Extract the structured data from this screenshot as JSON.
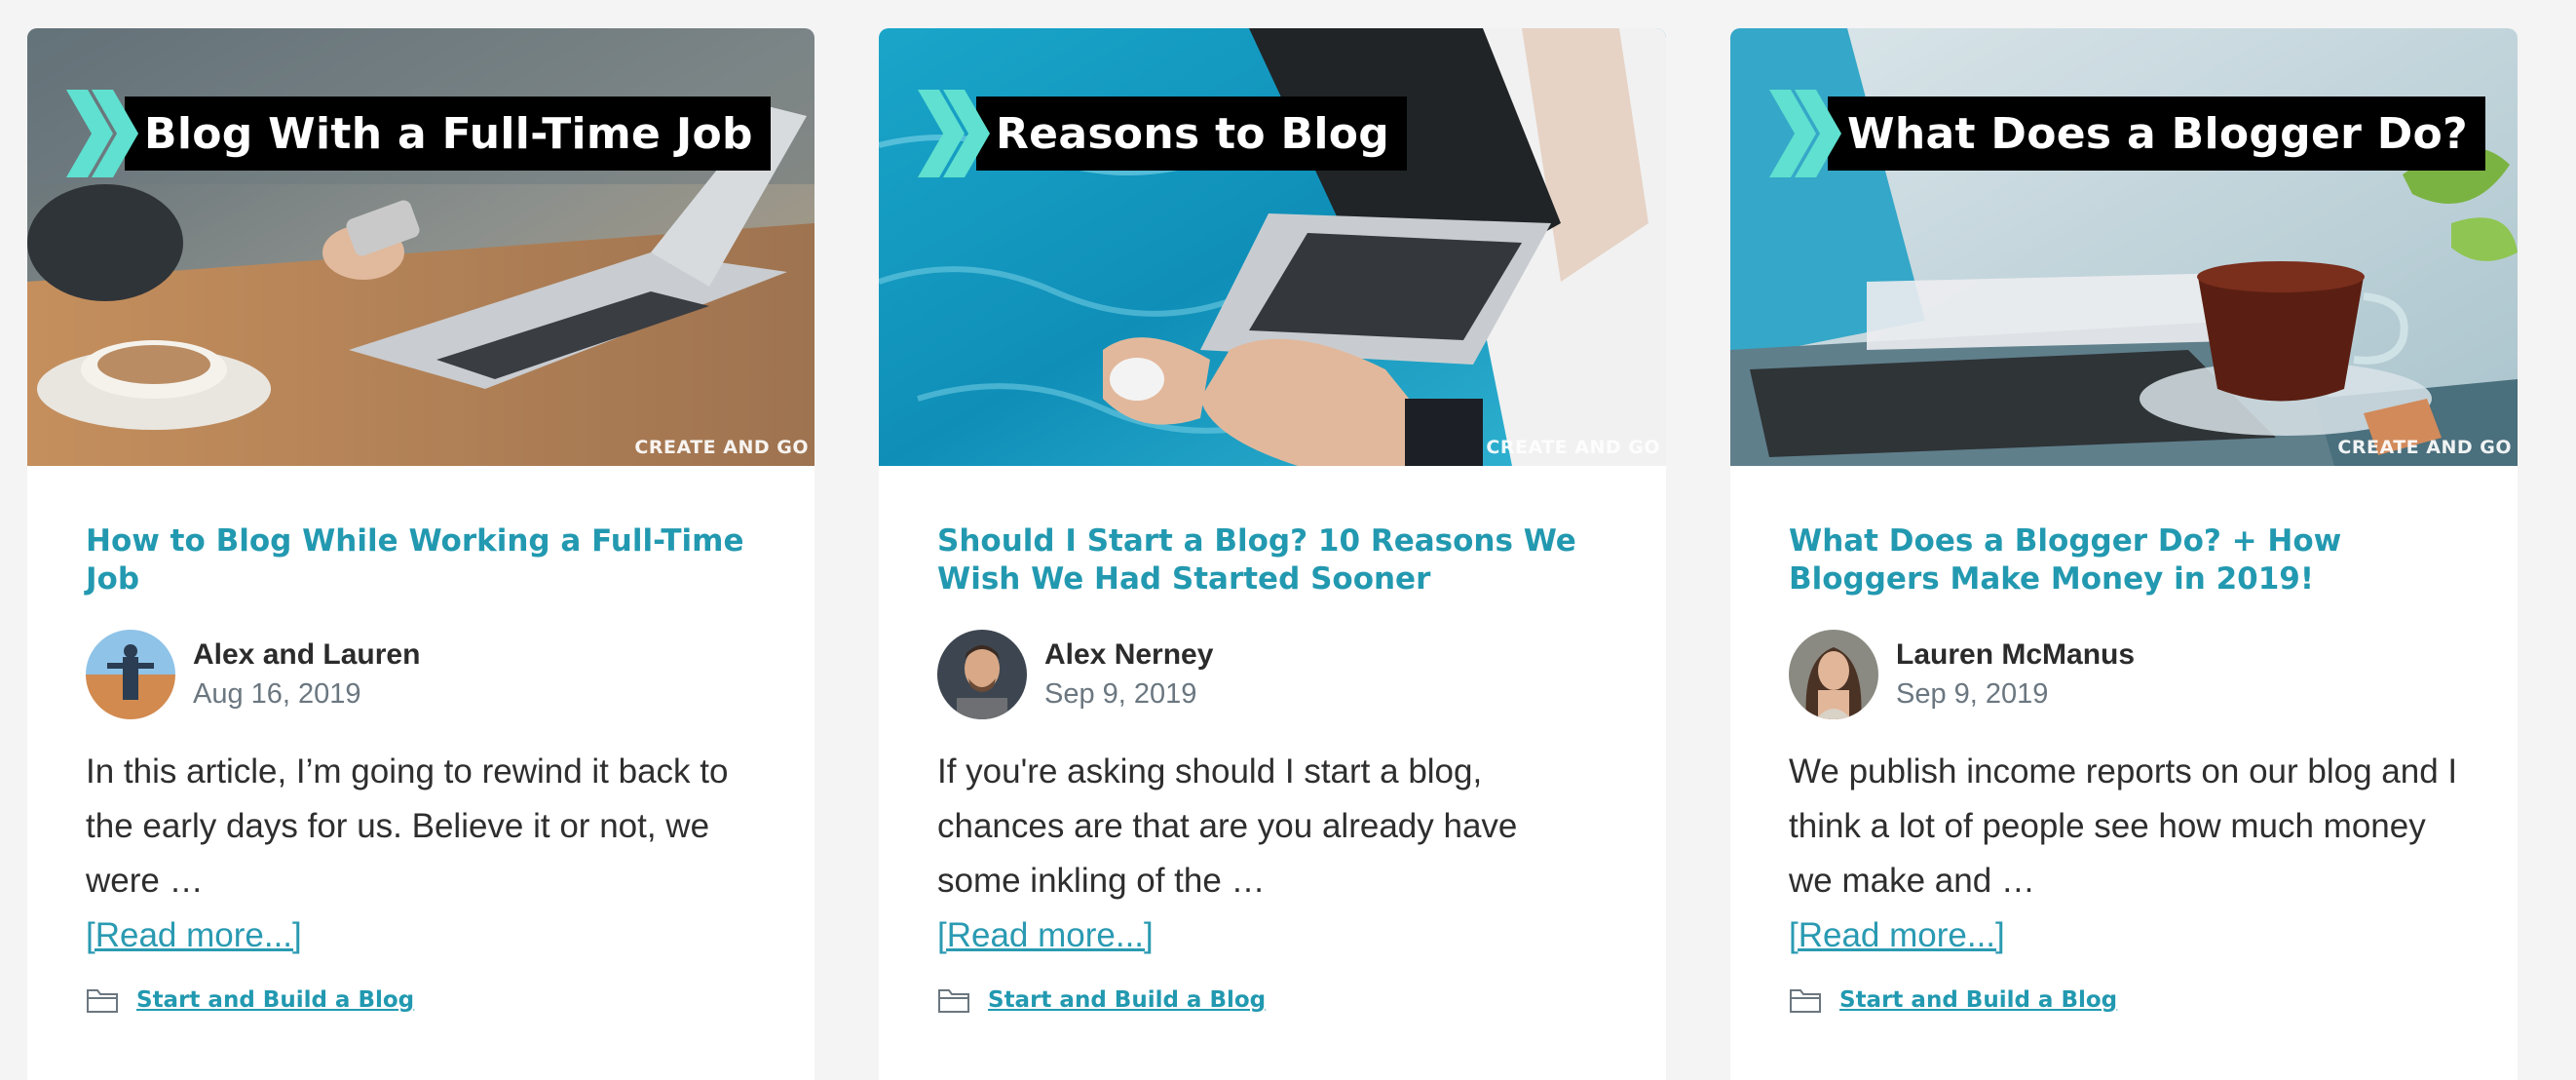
{
  "posts": [
    {
      "image_title": "Blog With a Full-Time Job",
      "watermark": "CREATE AND GO",
      "title": "How to Blog While Working a Full-Time Job",
      "author": "Alex and Lauren",
      "date": "Aug 16, 2019",
      "excerpt": "In this article, I’m going to rewind it back to the early days for us. Believe it or not, we were …",
      "read_more": "[Read more...]",
      "category": "Start and Build a Blog"
    },
    {
      "image_title": "Reasons to Blog",
      "watermark": "CREATE AND GO",
      "title": "Should I Start a Blog? 10 Reasons We Wish We Had Started Sooner",
      "author": "Alex Nerney",
      "date": "Sep 9, 2019",
      "excerpt": "If you're asking should I start a blog, chances are that are you already have some inkling of the …",
      "read_more": "[Read more...]",
      "category": "Start and Build a Blog"
    },
    {
      "image_title": "What Does a Blogger Do?",
      "watermark": "CREATE AND GO",
      "title": "What Does a Blogger Do? + How Bloggers Make Money in 2019!",
      "author": "Lauren McManus",
      "date": "Sep 9, 2019",
      "excerpt": "We publish income reports on our blog and I think a lot of people see how much money we make and …",
      "read_more": "[Read more...]",
      "category": "Start and Build a Blog"
    }
  ],
  "colors": {
    "accent": "#2299b0",
    "chevron": "#5fe0d0",
    "banner_bg": "#000000",
    "page_bg": "#f4f4f4"
  },
  "icons": {
    "category": "folder-icon"
  }
}
